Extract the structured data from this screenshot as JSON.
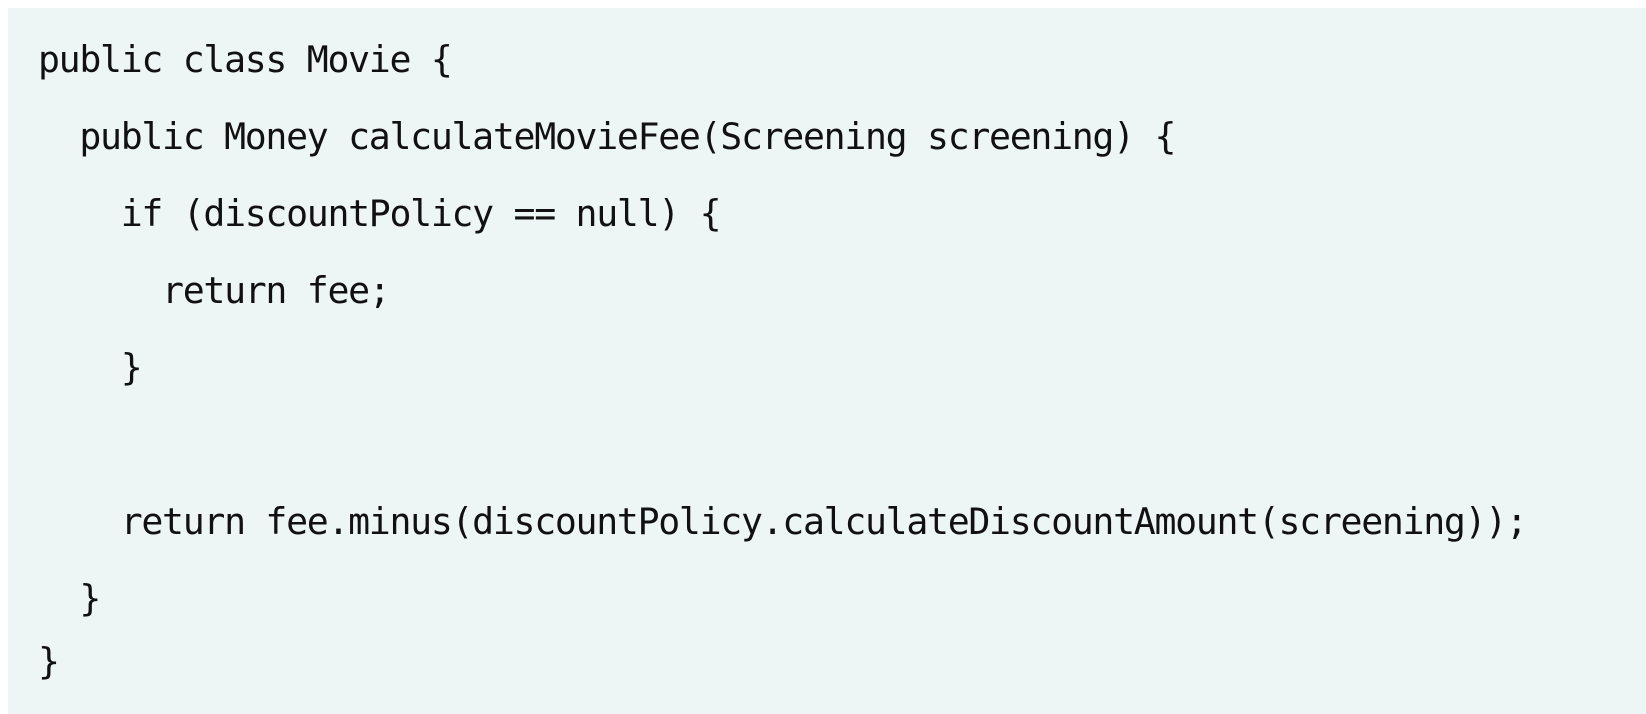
{
  "code": {
    "language": "java",
    "background_color": "#eef6f5",
    "text_color": "#111111",
    "lines": [
      "public class Movie {",
      "  public Money calculateMovieFee(Screening screening) {",
      "    if (discountPolicy == null) {",
      "      return fee;",
      "    }",
      "",
      "    return fee.minus(discountPolicy.calculateDiscountAmount(screening));",
      "  }",
      "}"
    ]
  }
}
